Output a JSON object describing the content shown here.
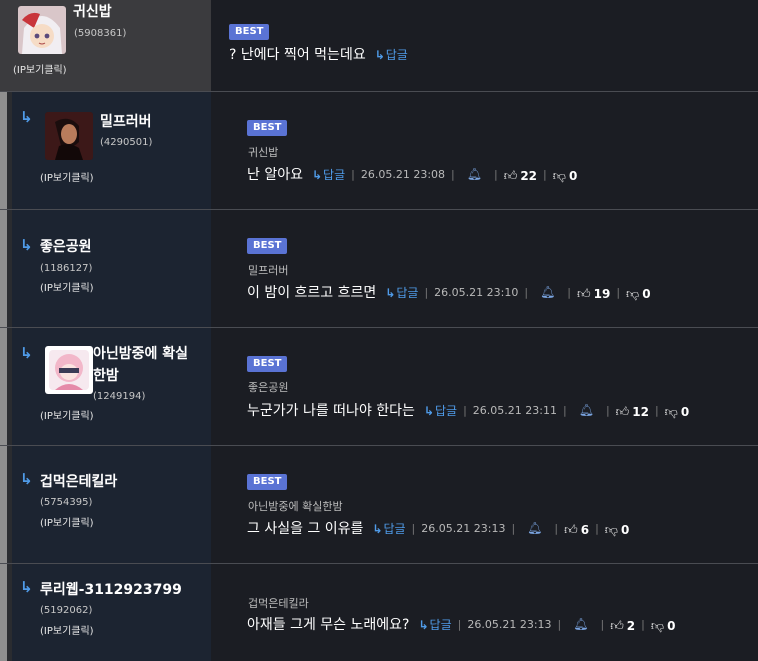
{
  "ip_click_label": "(IP보기클릭)",
  "best_label": "BEST",
  "reply_label": "답글",
  "top": {
    "username": "귀신밥",
    "user_id": "(5908361)",
    "text": "? 난에다 찍어 먹는데요"
  },
  "comments": [
    {
      "username": "밀프러버",
      "user_id": "(4290501)",
      "best": true,
      "parent": "귀신밥",
      "text": "난 알아요",
      "date": "26.05.21 23:08",
      "likes": "22",
      "dislikes": "0"
    },
    {
      "username": "좋은공원",
      "user_id": "(1186127)",
      "best": true,
      "parent": "밀프러버",
      "text": "이 밤이 흐르고 흐르면",
      "date": "26.05.21 23:10",
      "likes": "19",
      "dislikes": "0"
    },
    {
      "username_line1": "아닌밤중에 확실",
      "username_line2": "한밤",
      "user_id": "(1249194)",
      "best": true,
      "parent": "좋은공원",
      "text": "누군가가 나를 떠나야 한다는",
      "date": "26.05.21 23:11",
      "likes": "12",
      "dislikes": "0"
    },
    {
      "username": "겁먹은테킬라",
      "user_id": "(5754395)",
      "best": true,
      "parent": "아닌밤중에 확실한밤",
      "text": "그 사실을 그 이유를",
      "date": "26.05.21 23:13",
      "likes": "6",
      "dislikes": "0"
    },
    {
      "username": "루리웹-3112923799",
      "user_id": "(5192062)",
      "best": false,
      "parent": "겁먹은테킬라",
      "text": "아재들 그게 무슨 노래에요?",
      "date": "26.05.21 23:13",
      "likes": "2",
      "dislikes": "0"
    }
  ]
}
